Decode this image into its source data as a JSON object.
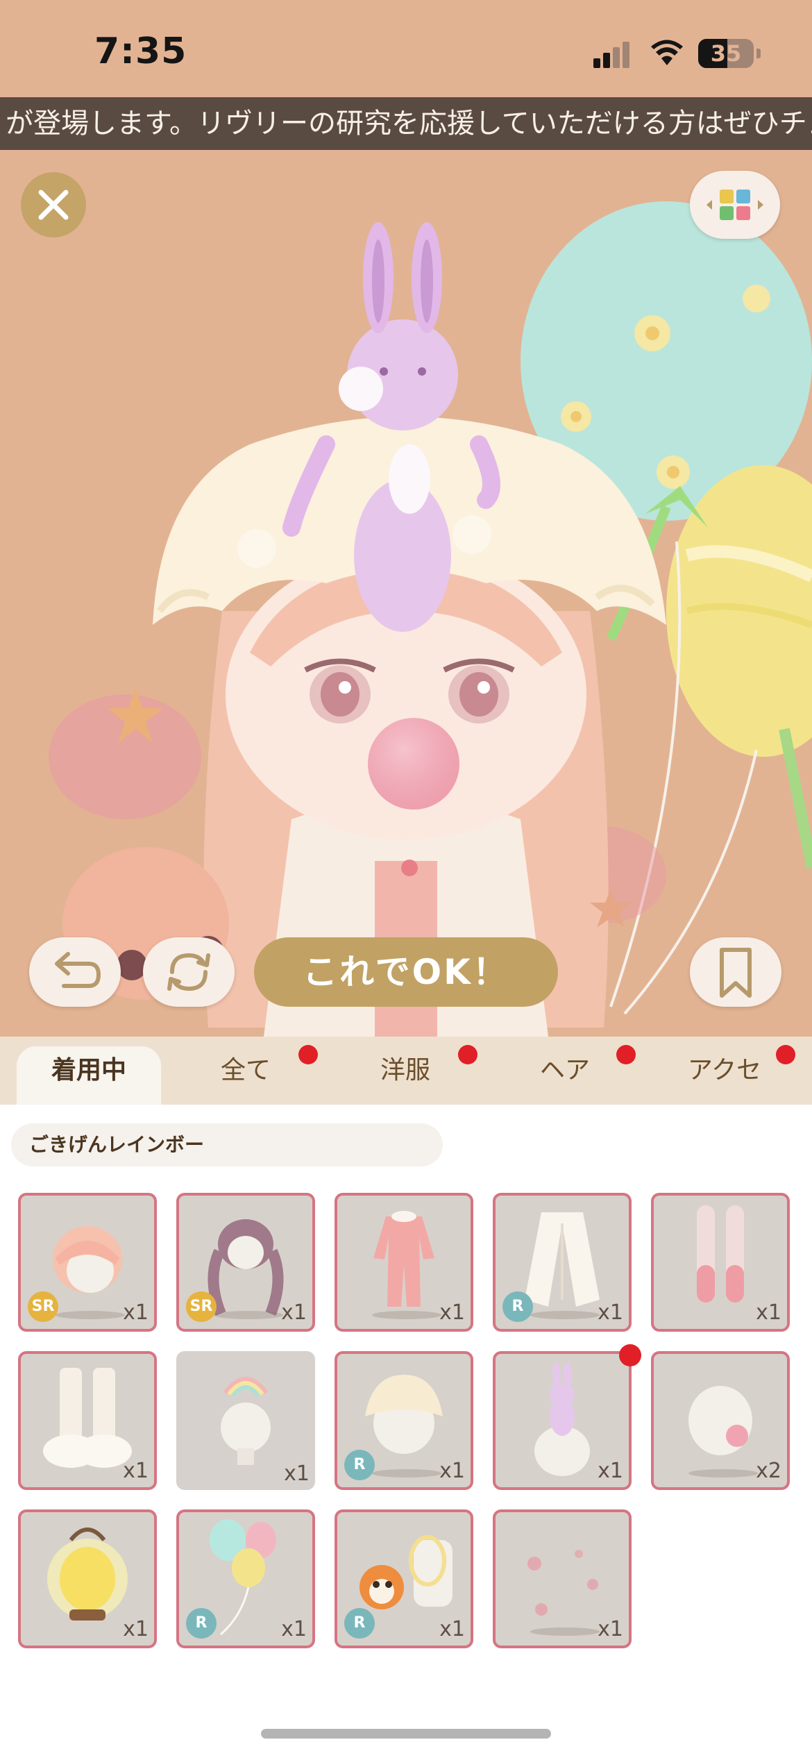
{
  "status_bar": {
    "time": "7:35",
    "battery": "35"
  },
  "ticker": {
    "text": "が登場します。リヴリーの研究を応援していただける方はぜひチェッ"
  },
  "buttons": {
    "ok_label": "これでOK！"
  },
  "tabs": [
    {
      "label": "着用中",
      "active": true,
      "badge": false
    },
    {
      "label": "全て",
      "active": false,
      "badge": true
    },
    {
      "label": "洋服",
      "active": false,
      "badge": true
    },
    {
      "label": "ヘア",
      "active": false,
      "badge": true
    },
    {
      "label": "アクセ",
      "active": false,
      "badge": true
    }
  ],
  "set_name": "ごきげんレインボー",
  "items": [
    {
      "name": "peach-bob-hair",
      "qty": "x1",
      "rarity": "SR"
    },
    {
      "name": "purple-braids-hair",
      "qty": "x1",
      "rarity": "SR"
    },
    {
      "name": "pink-pajamas",
      "qty": "x1",
      "rarity": ""
    },
    {
      "name": "fluffy-white-coat",
      "qty": "x1",
      "rarity": "R"
    },
    {
      "name": "pink-socks",
      "qty": "x1",
      "rarity": ""
    },
    {
      "name": "fluffy-boots",
      "qty": "x1",
      "rarity": ""
    },
    {
      "name": "rainbow-accessory",
      "qty": "x1",
      "rarity": ""
    },
    {
      "name": "frilly-bonnet",
      "qty": "x1",
      "rarity": "R"
    },
    {
      "name": "bunny-on-head",
      "qty": "x1",
      "rarity": ""
    },
    {
      "name": "bubble-gum",
      "qty": "x2",
      "rarity": ""
    },
    {
      "name": "glowing-lantern",
      "qty": "x1",
      "rarity": ""
    },
    {
      "name": "easter-balloons",
      "qty": "x1",
      "rarity": "R"
    },
    {
      "name": "bear-and-bottle",
      "qty": "x1",
      "rarity": "R"
    },
    {
      "name": "pink-sparkles",
      "qty": "x1",
      "rarity": ""
    }
  ],
  "colors": {
    "stage_bg": "#e2b393",
    "accent_gold": "#c1a264",
    "tab_bar": "#eee0cf",
    "item_border": "#d57583",
    "badge_red": "#e01f27"
  }
}
